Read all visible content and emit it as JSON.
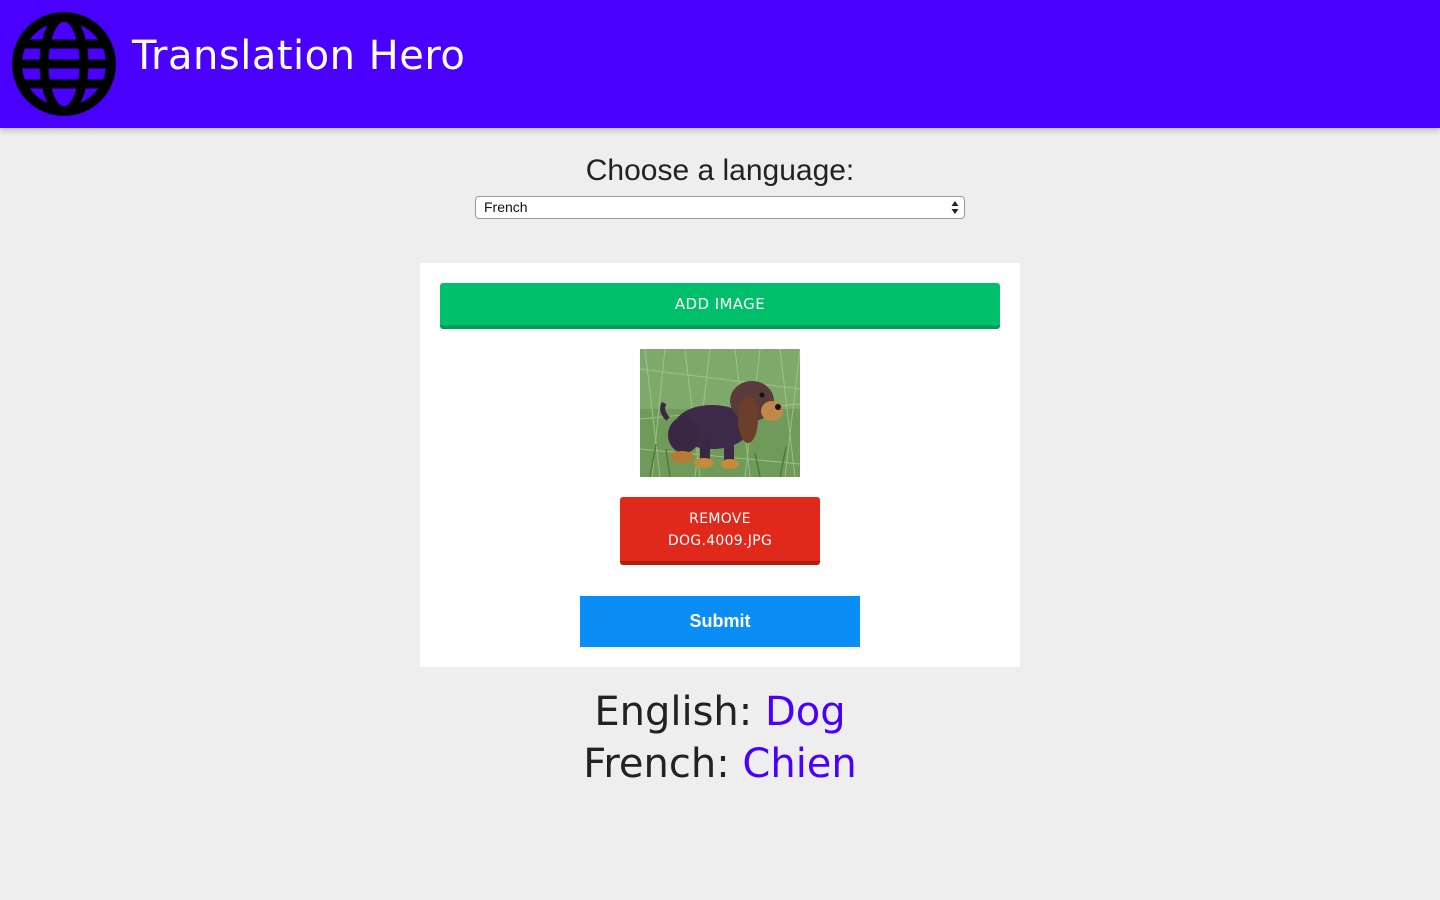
{
  "header": {
    "app_title": "Translation Hero",
    "logo_icon": "globe-icon",
    "background_color": "#4a00ff"
  },
  "language": {
    "heading": "Choose a language:",
    "selected": "French"
  },
  "upload": {
    "add_label": "ADD IMAGE",
    "add_color": "#00bf6a",
    "preview_subject": "dog photo",
    "remove_line1": "REMOVE",
    "remove_line2": "DOG.4009.JPG",
    "remove_color": "#e0291a",
    "submit_label": "Submit",
    "submit_color": "#0a8ef5"
  },
  "results": {
    "source_lang": "English:",
    "source_word": "Dog",
    "target_lang": "French:",
    "target_word": "Chien",
    "highlight_color": "#4a00ff"
  }
}
